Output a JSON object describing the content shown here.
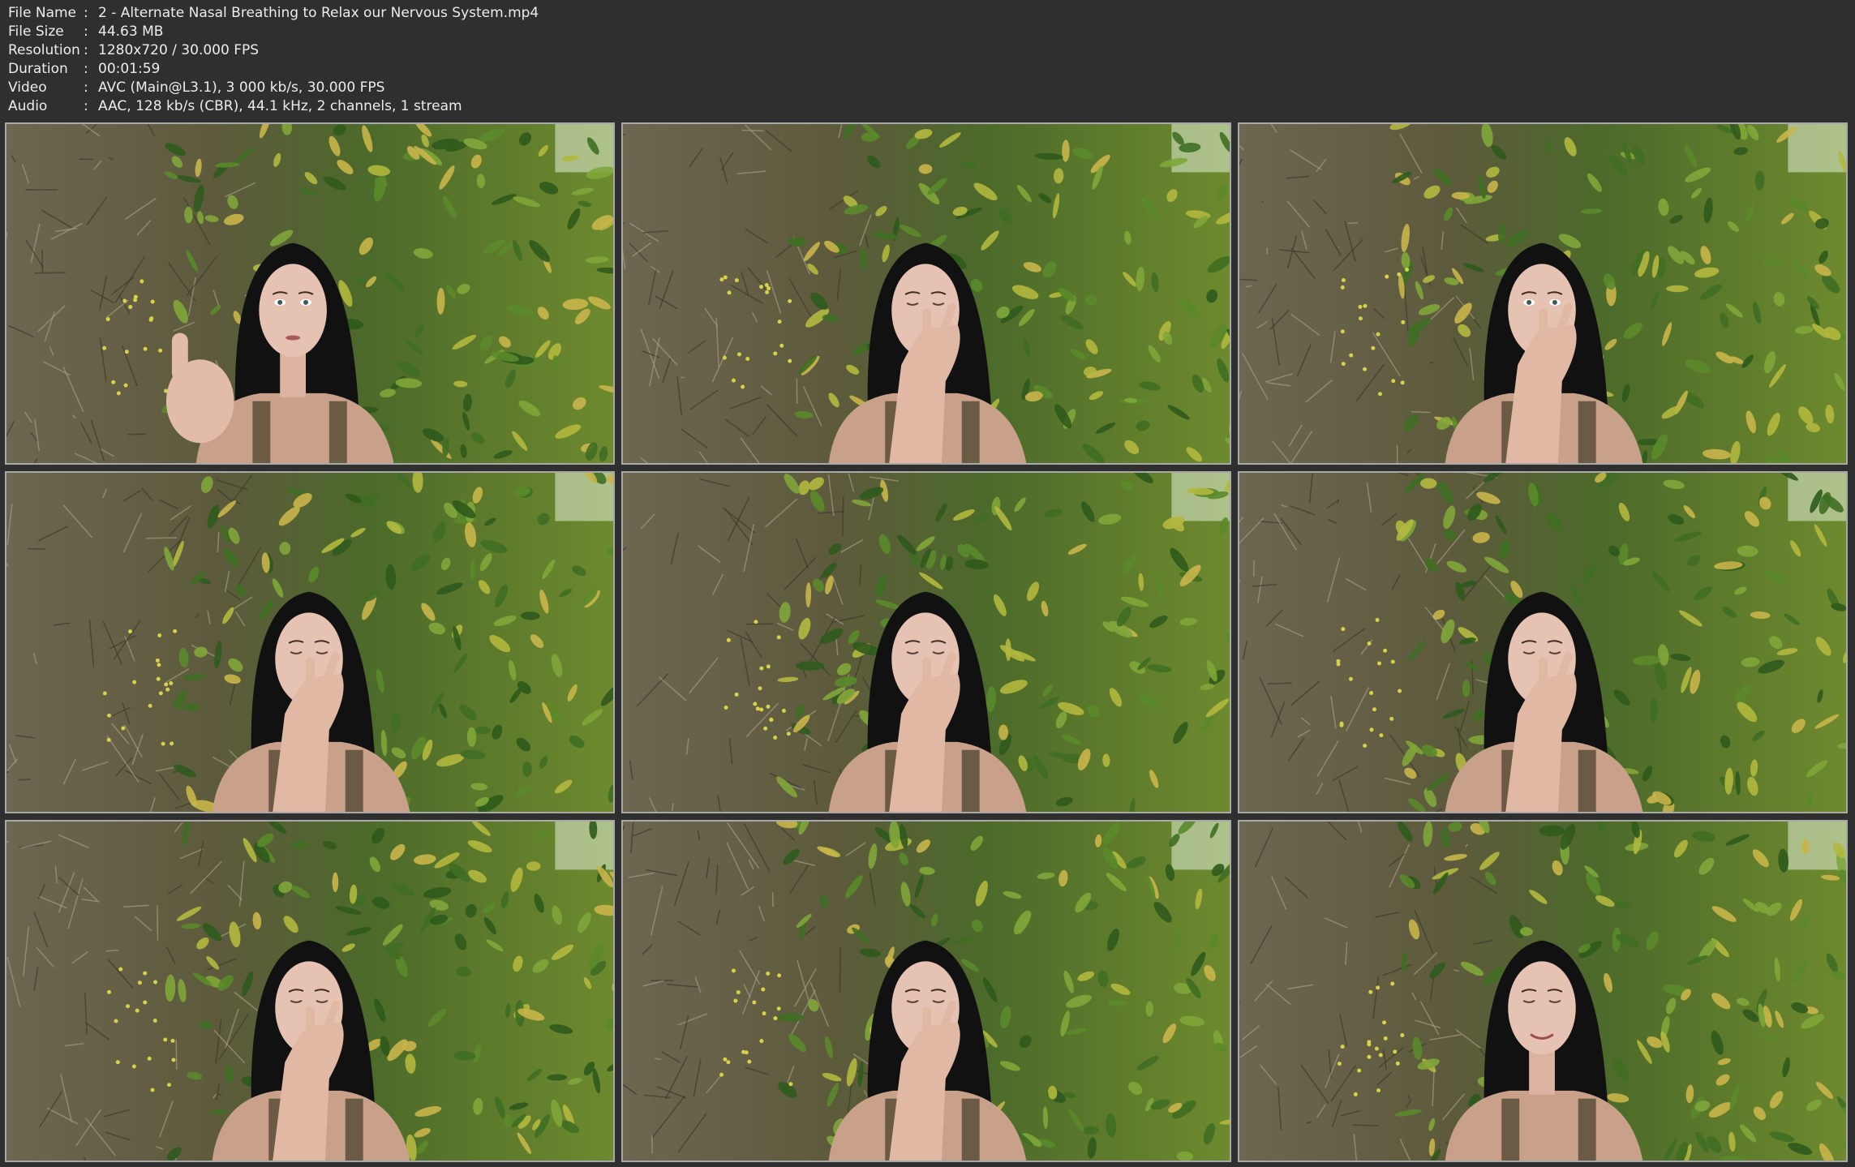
{
  "file_info": {
    "rows": [
      {
        "label": "File Name",
        "value": "2 - Alternate Nasal Breathing to Relax our Nervous System.mp4"
      },
      {
        "label": "File Size",
        "value": "44.63 MB"
      },
      {
        "label": "Resolution",
        "value": "1280x720 / 30.000 FPS"
      },
      {
        "label": "Duration",
        "value": "00:01:59"
      },
      {
        "label": "Video",
        "value": "AVC (Main@L3.1), 3 000 kb/s, 30.000 FPS"
      },
      {
        "label": "Audio",
        "value": "AAC, 128 kb/s (CBR), 44.1 kHz, 2 channels, 1 stream"
      }
    ],
    "separator": ":"
  },
  "thumbnails": [
    {
      "pose": "thumbs-up",
      "eyes": "open"
    },
    {
      "pose": "hand-at-nose",
      "eyes": "closed"
    },
    {
      "pose": "hand-at-nose",
      "eyes": "open"
    },
    {
      "pose": "hand-at-nose",
      "eyes": "closed"
    },
    {
      "pose": "hand-at-nose",
      "eyes": "closed"
    },
    {
      "pose": "hand-at-nose",
      "eyes": "closed"
    },
    {
      "pose": "hand-at-nose",
      "eyes": "closed"
    },
    {
      "pose": "hand-at-nose",
      "eyes": "closed"
    },
    {
      "pose": "smiling",
      "eyes": "closed"
    }
  ],
  "colors": {
    "background": "#2f2f2f",
    "text": "#ececec",
    "thumb_border": "#a9a9a9"
  }
}
